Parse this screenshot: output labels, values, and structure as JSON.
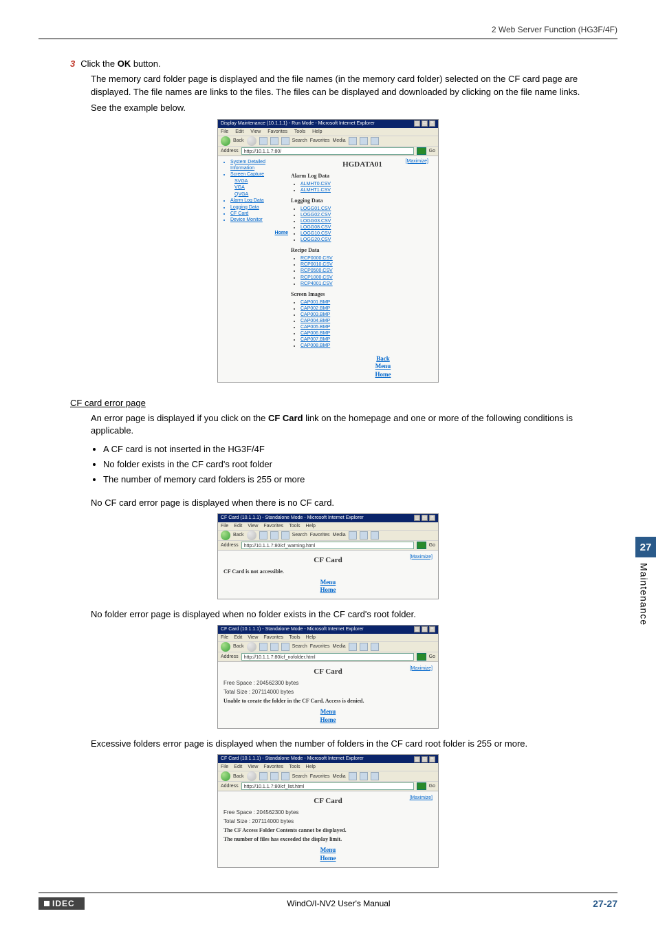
{
  "header": {
    "section": "2 Web Server Function (HG3F/4F)"
  },
  "step": {
    "num": "3",
    "text_prefix": "Click the ",
    "bold": "OK",
    "text_suffix": " button."
  },
  "paras": {
    "p1": "The memory card folder page is displayed and the file names (in the memory card folder) selected on the CF card page are displayed. The file names are links to the files. The files can be displayed and downloaded by clicking on the file name links.",
    "p2": "See the example below."
  },
  "browser": {
    "menu": [
      "File",
      "Edit",
      "View",
      "Favorites",
      "Tools",
      "Help"
    ],
    "toolbar": {
      "back": "Back",
      "search": "Search",
      "favorites": "Favorites",
      "media": "Media"
    },
    "address_label": "Address",
    "go": "Go"
  },
  "ss1": {
    "title": "Display Maintenance (10.1.1.1) - Run Mode - Microsoft Internet Explorer",
    "address": "http://10.1.1.7:80/",
    "left_nav": {
      "items": [
        "System Detailed Information"
      ],
      "screen_capture": "Screen Capture",
      "sizes": [
        "SVGA",
        "VGA",
        "QVGA"
      ],
      "more": [
        "Alarm Log Data",
        "Logging Data",
        "CF Card",
        "Device Monitor"
      ],
      "home": "Home"
    },
    "page_title": "HGDATA01",
    "maximize": "[Maximize]",
    "sections": [
      {
        "title": "Alarm Log Data",
        "files": [
          "ALMHT0.CSV",
          "ALMHT1.CSV"
        ]
      },
      {
        "title": "Logging Data",
        "files": [
          "LOGG01.CSV",
          "LOGG02.CSV",
          "LOGG03.CSV",
          "LOGG08.CSV",
          "LOGG10.CSV",
          "LOGG20.CSV"
        ]
      },
      {
        "title": "Recipe Data",
        "files": [
          "RCP0000.CSV",
          "RCP0010.CSV",
          "RCP0500.CSV",
          "RCP1000.CSV",
          "RCP4001.CSV"
        ]
      },
      {
        "title": "Screen Images",
        "files": [
          "CAP001.BMP",
          "CAP002.BMP",
          "CAP003.BMP",
          "CAP004.BMP",
          "CAP005.BMP",
          "CAP006.BMP",
          "CAP007.BMP",
          "CAP008.BMP"
        ]
      }
    ],
    "bottom_links": [
      "Back",
      "Menu",
      "Home"
    ]
  },
  "cf_error": {
    "heading": "CF card error page",
    "intro_a": "An error page is displayed if you click on the ",
    "intro_bold": "CF Card",
    "intro_b": " link on the homepage and one or more of the following conditions is applicable.",
    "bullets": [
      "A CF card is not inserted in the HG3F/4F",
      "No folder exists in the CF card's root folder",
      "The number of memory card folders is 255 or more"
    ]
  },
  "ss2": {
    "caption": "No CF card error page is displayed when there is no CF card.",
    "title": "CF Card (10.1.1.1) - Standalone Mode - Microsoft Internet Explorer",
    "address": "http://10.1.1.7:80/cf_warning.html",
    "page_title": "CF Card",
    "maximize": "[Maximize]",
    "msg": "CF Card is not accessible.",
    "links": [
      "Menu",
      "Home"
    ]
  },
  "ss3": {
    "caption": "No folder error page is displayed when no folder exists in the CF card's root folder.",
    "title": "CF Card (10.1.1.1) - Standalone Mode - Microsoft Internet Explorer",
    "address": "http://10.1.1.7:80/cf_nofolder.html",
    "page_title": "CF Card",
    "maximize": "[Maximize]",
    "free": "Free Space : 204562300 bytes",
    "total": "Total Size : 207114000 bytes",
    "msg": "Unable to create the folder in the CF Card. Access is denied.",
    "links": [
      "Menu",
      "Home"
    ]
  },
  "ss4": {
    "caption": "Excessive folders error page is displayed when the number of folders in the CF card root folder is 255 or more.",
    "title": "CF Card (10.1.1.1) - Standalone Mode - Microsoft Internet Explorer",
    "address": "http://10.1.1.7:80/cf_list.html",
    "page_title": "CF Card",
    "maximize": "[Maximize]",
    "free": "Free Space : 204562300 bytes",
    "total": "Total Size : 207114000 bytes",
    "msg1": "The CF Access Folder Contents cannot be displayed.",
    "msg2": "The number of files has exceeded the display limit.",
    "links": [
      "Menu",
      "Home"
    ]
  },
  "side": {
    "num": "27",
    "label": "Maintenance"
  },
  "footer": {
    "brand": "IDEC",
    "center": "WindO/I-NV2 User's Manual",
    "page": "27-27"
  }
}
